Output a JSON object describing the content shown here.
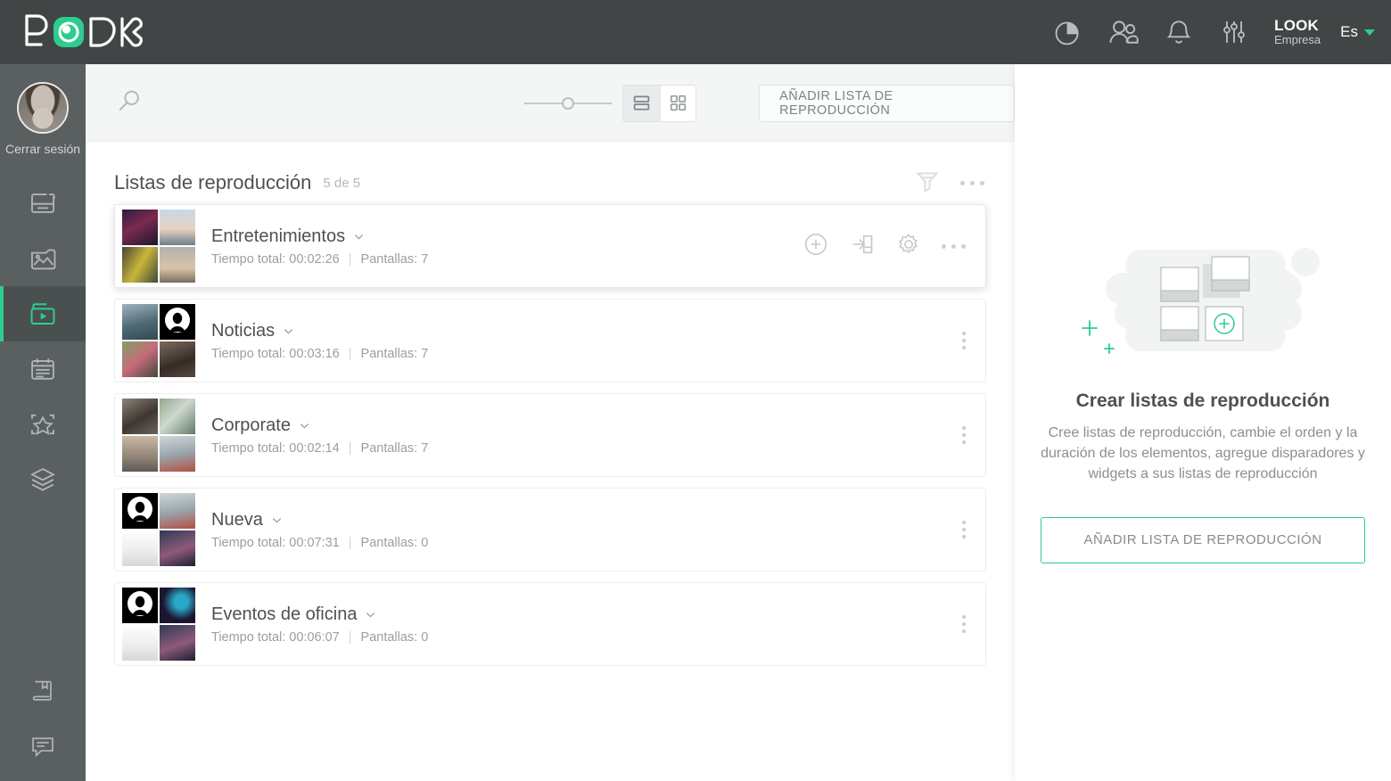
{
  "header": {
    "logo_text": "LOOK",
    "icons": [
      "pie-chart-icon",
      "users-icon",
      "bell-icon",
      "sliders-icon"
    ],
    "brand_name": "LOOK",
    "brand_sub": "Empresa",
    "language": "Es"
  },
  "sidebar": {
    "logout_label": "Cerrar sesión",
    "items": [
      {
        "name": "screens",
        "icon": "screen-icon",
        "active": false
      },
      {
        "name": "media",
        "icon": "image-icon",
        "active": false
      },
      {
        "name": "playlists",
        "icon": "playlist-play-icon",
        "active": true
      },
      {
        "name": "schedule",
        "icon": "calendar-icon",
        "active": false
      },
      {
        "name": "apps",
        "icon": "star-scan-icon",
        "active": false
      },
      {
        "name": "layouts",
        "icon": "layers-icon",
        "active": false
      }
    ],
    "bottom_items": [
      {
        "name": "manual",
        "icon": "book-icon"
      },
      {
        "name": "support",
        "icon": "chat-icon"
      }
    ]
  },
  "toolbar": {
    "search_icon": "search-icon",
    "zoom_slider_value": 45,
    "view_list_label": "list-view",
    "view_grid_label": "grid-view",
    "active_view": "list",
    "add_playlist_label": "AÑADIR LISTA DE REPRODUCCIÓN"
  },
  "list_header": {
    "title": "Listas de reproducción",
    "count": "5 de 5",
    "filter_icon": "filter-icon",
    "more_icon": "more-horizontal-icon"
  },
  "playlists": [
    {
      "name": "Entretenimientos",
      "total_time_label": "Tiempo total: 00:02:26",
      "screens_label": "Pantallas: 7",
      "hovered": true,
      "thumbs": [
        "t-neon-person",
        "t-sky-plane",
        "t-train",
        "t-beach"
      ]
    },
    {
      "name": "Noticias",
      "total_time_label": "Tiempo total: 00:03:16",
      "screens_label": "Pantallas: 7",
      "hovered": false,
      "thumbs": [
        "t-boat",
        "t-avatar-black",
        "t-gym",
        "t-guitar"
      ]
    },
    {
      "name": "Corporate",
      "total_time_label": "Tiempo total: 00:02:14",
      "screens_label": "Pantallas: 7",
      "hovered": false,
      "thumbs": [
        "t-crowd",
        "t-windmill",
        "t-sea",
        "t-bridge-fog"
      ]
    },
    {
      "name": "Nueva",
      "total_time_label": "Tiempo total: 00:07:31",
      "screens_label": "Pantallas: 0",
      "hovered": false,
      "thumbs": [
        "t-avatar-black",
        "t-bridge-fog",
        "t-white-statue",
        "t-city-night"
      ]
    },
    {
      "name": "Eventos de oficina",
      "total_time_label": "Tiempo total: 00:06:07",
      "screens_label": "Pantallas: 0",
      "hovered": false,
      "thumbs": [
        "t-avatar-black",
        "t-blue-wave",
        "t-white-statue",
        "t-city-night"
      ]
    }
  ],
  "row_actions": {
    "add_icon": "plus-circle-icon",
    "assign_icon": "assign-to-screen-icon",
    "settings_icon": "gear-icon",
    "more_icon": "more-horizontal-icon",
    "menu_icon": "more-vertical-icon",
    "expand_icon": "chevron-down-icon"
  },
  "right_panel": {
    "title": "Crear listas de reproducción",
    "description": "Cree listas de reproducción, cambie el orden y la duración de los elementos, agregue disparadores y widgets a sus listas de reproducción",
    "button_label": "AÑADIR LISTA DE REPRODUCCIÓN",
    "illustration": "playlist-cards-illustration"
  },
  "colors": {
    "accent": "#2ecc8f",
    "topbar": "#414546",
    "sidebar": "#5a5f60",
    "toolbar_bg": "#f4f6f6",
    "text_dark": "#4d5152",
    "text_muted": "#9a9fa0"
  }
}
